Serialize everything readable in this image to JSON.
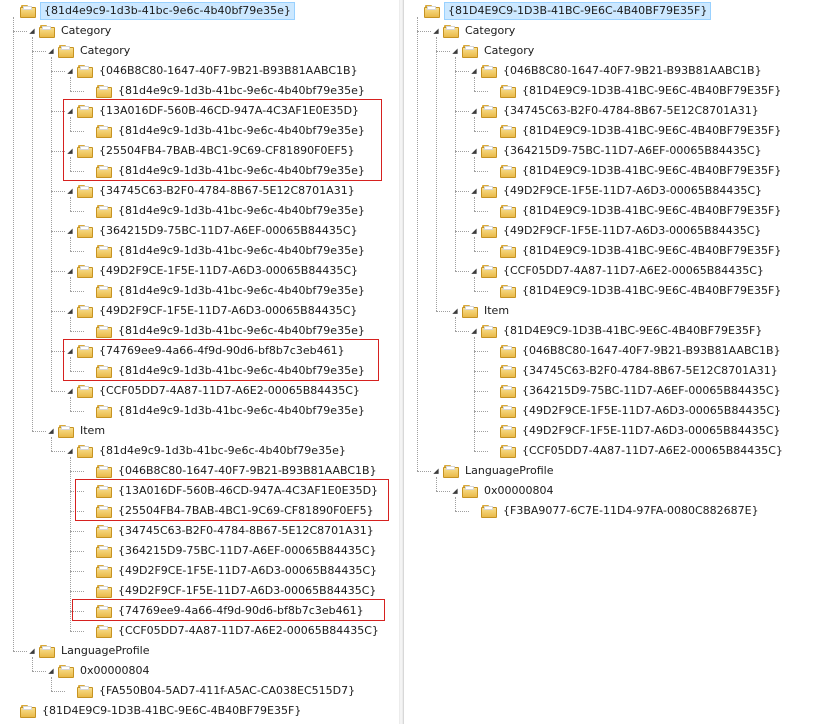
{
  "left_tree": {
    "root": "{81d4e9c9-1d3b-41bc-9e6c-4b40bf79e35e}",
    "category": "Category",
    "category_sub": "Category",
    "cat_items": [
      {
        "guid": "{046B8C80-1647-40F7-9B21-B93B81AABC1B}",
        "child": "{81d4e9c9-1d3b-41bc-9e6c-4b40bf79e35e}"
      },
      {
        "guid": "{13A016DF-560B-46CD-947A-4C3AF1E0E35D}",
        "child": "{81d4e9c9-1d3b-41bc-9e6c-4b40bf79e35e}"
      },
      {
        "guid": "{25504FB4-7BAB-4BC1-9C69-CF81890F0EF5}",
        "child": "{81d4e9c9-1d3b-41bc-9e6c-4b40bf79e35e}"
      },
      {
        "guid": "{34745C63-B2F0-4784-8B67-5E12C8701A31}",
        "child": "{81d4e9c9-1d3b-41bc-9e6c-4b40bf79e35e}"
      },
      {
        "guid": "{364215D9-75BC-11D7-A6EF-00065B84435C}",
        "child": "{81d4e9c9-1d3b-41bc-9e6c-4b40bf79e35e}"
      },
      {
        "guid": "{49D2F9CE-1F5E-11D7-A6D3-00065B84435C}",
        "child": "{81d4e9c9-1d3b-41bc-9e6c-4b40bf79e35e}"
      },
      {
        "guid": "{49D2F9CF-1F5E-11D7-A6D3-00065B84435C}",
        "child": "{81d4e9c9-1d3b-41bc-9e6c-4b40bf79e35e}"
      },
      {
        "guid": "{74769ee9-4a66-4f9d-90d6-bf8b7c3eb461}",
        "child": "{81d4e9c9-1d3b-41bc-9e6c-4b40bf79e35e}"
      },
      {
        "guid": "{CCF05DD7-4A87-11D7-A6E2-00065B84435C}",
        "child": "{81d4e9c9-1d3b-41bc-9e6c-4b40bf79e35e}"
      }
    ],
    "item": "Item",
    "item_sub": "{81d4e9c9-1d3b-41bc-9e6c-4b40bf79e35e}",
    "item_children": [
      "{046B8C80-1647-40F7-9B21-B93B81AABC1B}",
      "{13A016DF-560B-46CD-947A-4C3AF1E0E35D}",
      "{25504FB4-7BAB-4BC1-9C69-CF81890F0EF5}",
      "{34745C63-B2F0-4784-8B67-5E12C8701A31}",
      "{364215D9-75BC-11D7-A6EF-00065B84435C}",
      "{49D2F9CE-1F5E-11D7-A6D3-00065B84435C}",
      "{49D2F9CF-1F5E-11D7-A6D3-00065B84435C}",
      "{74769ee9-4a66-4f9d-90d6-bf8b7c3eb461}",
      "{CCF05DD7-4A87-11D7-A6E2-00065B84435C}"
    ],
    "language_profile": "LanguageProfile",
    "lang_id": "0x00000804",
    "lang_child": "{FA550B04-5AD7-411f-A5AC-CA038EC515D7}",
    "sibling": "{81D4E9C9-1D3B-41BC-9E6C-4B40BF79E35F}"
  },
  "right_tree": {
    "root": "{81D4E9C9-1D3B-41BC-9E6C-4B40BF79E35F}",
    "category": "Category",
    "category_sub": "Category",
    "cat_items": [
      {
        "guid": "{046B8C80-1647-40F7-9B21-B93B81AABC1B}",
        "child": "{81D4E9C9-1D3B-41BC-9E6C-4B40BF79E35F}"
      },
      {
        "guid": "{34745C63-B2F0-4784-8B67-5E12C8701A31}",
        "child": "{81D4E9C9-1D3B-41BC-9E6C-4B40BF79E35F}"
      },
      {
        "guid": "{364215D9-75BC-11D7-A6EF-00065B84435C}",
        "child": "{81D4E9C9-1D3B-41BC-9E6C-4B40BF79E35F}"
      },
      {
        "guid": "{49D2F9CE-1F5E-11D7-A6D3-00065B84435C}",
        "child": "{81D4E9C9-1D3B-41BC-9E6C-4B40BF79E35F}"
      },
      {
        "guid": "{49D2F9CF-1F5E-11D7-A6D3-00065B84435C}",
        "child": "{81D4E9C9-1D3B-41BC-9E6C-4B40BF79E35F}"
      },
      {
        "guid": "{CCF05DD7-4A87-11D7-A6E2-00065B84435C}",
        "child": "{81D4E9C9-1D3B-41BC-9E6C-4B40BF79E35F}"
      }
    ],
    "item": "Item",
    "item_sub": "{81D4E9C9-1D3B-41BC-9E6C-4B40BF79E35F}",
    "item_children": [
      "{046B8C80-1647-40F7-9B21-B93B81AABC1B}",
      "{34745C63-B2F0-4784-8B67-5E12C8701A31}",
      "{364215D9-75BC-11D7-A6EF-00065B84435C}",
      "{49D2F9CE-1F5E-11D7-A6D3-00065B84435C}",
      "{49D2F9CF-1F5E-11D7-A6D3-00065B84435C}",
      "{CCF05DD7-4A87-11D7-A6E2-00065B84435C}"
    ],
    "language_profile": "LanguageProfile",
    "lang_id": "0x00000804",
    "lang_child": "{F3BA9077-6C7E-11D4-97FA-0080C882687E}"
  },
  "colors": {
    "highlight": "#d6211f",
    "selection_bg": "#cce8ff",
    "selection_border": "#99d1ff"
  }
}
